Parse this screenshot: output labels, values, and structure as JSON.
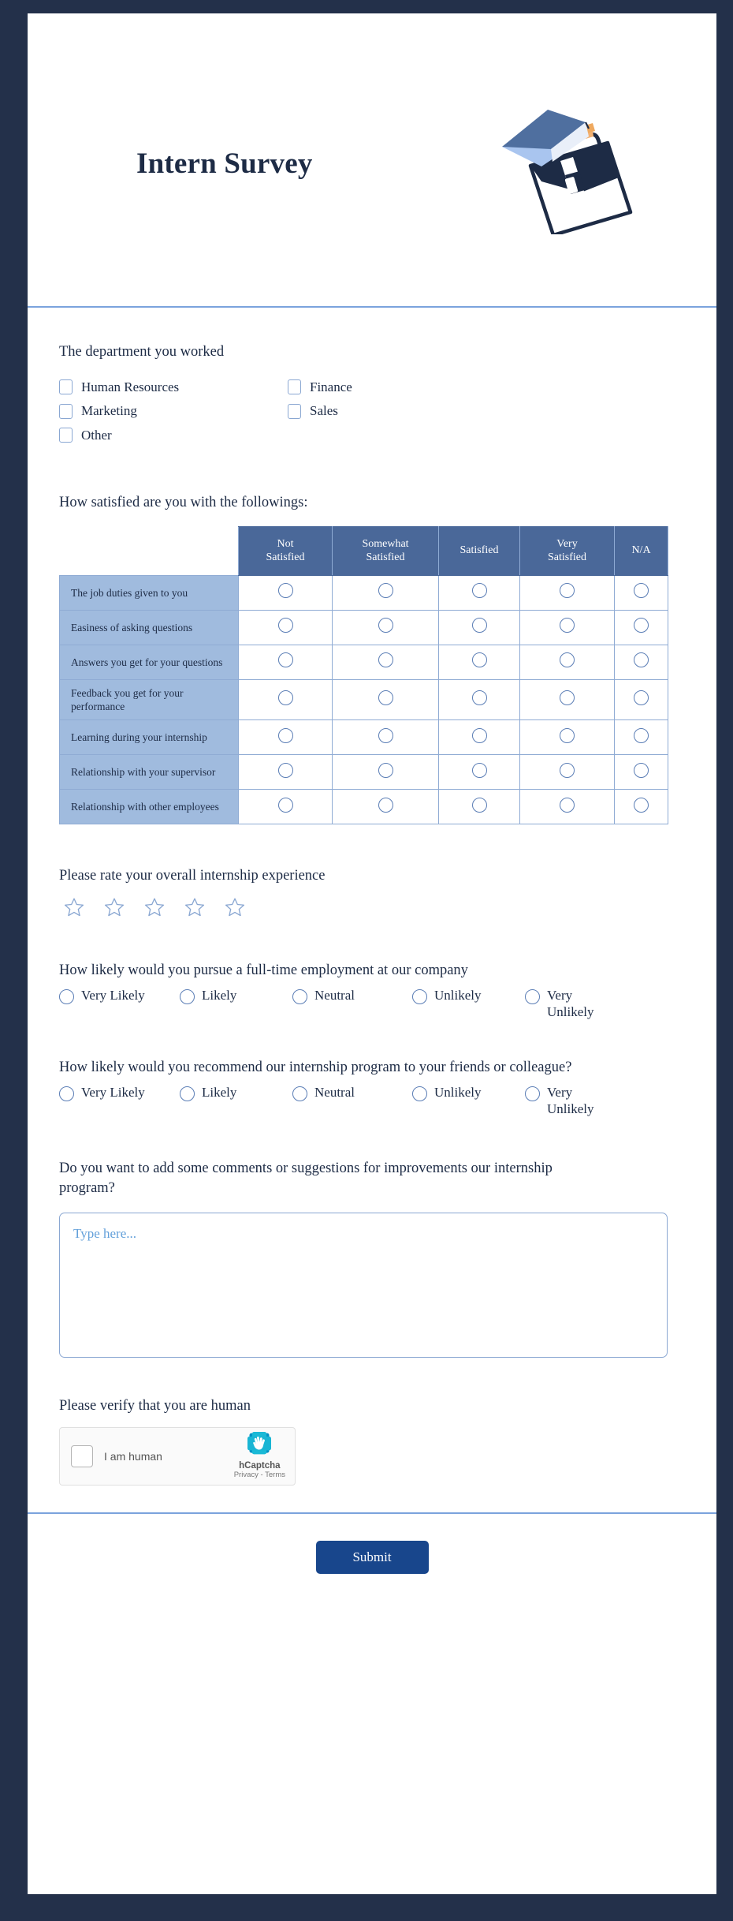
{
  "theme": {
    "frame_navy": "#23304a",
    "divider_blue": "#7ba3dd",
    "header_cell_blue": "#4a6899",
    "row_label_blue": "#a0bbde",
    "text_navy": "#1d2b45",
    "submit_blue": "#18468c",
    "placeholder_blue": "#5b9bd5"
  },
  "header": {
    "title": "Intern Survey",
    "illustration_name": "graduation-cap-briefcase-illustration"
  },
  "department_question": {
    "label": "The department you worked",
    "options": [
      {
        "label": "Human Resources",
        "column": 1
      },
      {
        "label": "Finance",
        "column": 2
      },
      {
        "label": "Marketing",
        "column": 1
      },
      {
        "label": "Sales",
        "column": 2
      },
      {
        "label": "Other",
        "column": 1
      }
    ]
  },
  "satisfaction_matrix": {
    "label": "How satisfied are you with the followings:",
    "columns": [
      "Not Satisfied",
      "Somewhat Satisfied",
      "Satisfied",
      "Very Satisfied",
      "N/A"
    ],
    "column_lines": [
      [
        "Not",
        "Satisfied"
      ],
      [
        "Somewhat",
        "Satisfied"
      ],
      [
        "Satisfied"
      ],
      [
        "Very",
        "Satisfied"
      ],
      [
        "N/A"
      ]
    ],
    "rows": [
      "The job duties given to you",
      "Easiness of asking questions",
      "Answers you get for your questions",
      "Feedback you get for your performance",
      "Learning during your internship",
      "Relationship with your supervisor",
      "Relationship with other employees"
    ]
  },
  "star_rating": {
    "label": "Please rate your overall internship experience",
    "count": 5,
    "selected": 0
  },
  "employment_question": {
    "label": "How likely would you pursue a full-time employment at our company",
    "options": [
      "Very Likely",
      "Likely",
      "Neutral",
      "Unlikely",
      "Very Unlikely"
    ]
  },
  "recommend_question": {
    "label": "How likely would you recommend our internship program to your friends or colleague?",
    "options": [
      "Very Likely",
      "Likely",
      "Neutral",
      "Unlikely",
      "Very Unlikely"
    ]
  },
  "comments_question": {
    "label": "Do you want to add some comments or suggestions for improvements our internship program?",
    "placeholder": "Type here...",
    "value": ""
  },
  "captcha": {
    "label": "Please verify that you are human",
    "checkbox_label": "I am human",
    "brand": "hCaptcha",
    "terms": "Privacy - Terms",
    "icon_name": "hcaptcha-hand-icon"
  },
  "footer": {
    "submit_label": "Submit"
  }
}
